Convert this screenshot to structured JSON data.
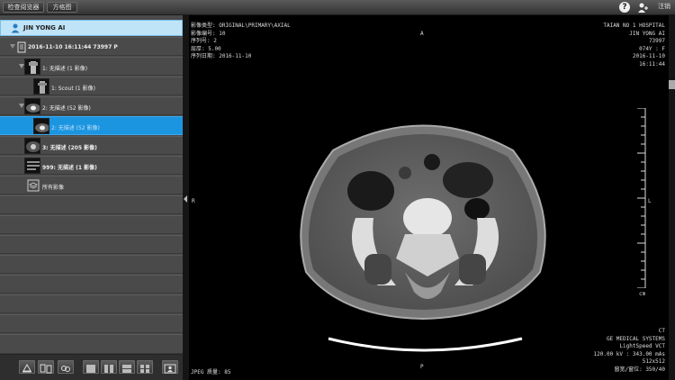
{
  "toolbar": {
    "btn1": "检查阅览器",
    "btn2": "方格图",
    "help": "?",
    "exit": "注销"
  },
  "patient": {
    "name": "JIN YONG AI"
  },
  "tree": {
    "study": "2016-11-10 16:11:44 73997 P",
    "series": [
      {
        "label": "1: 无描述 (1 影像)"
      },
      {
        "label": "1: Scout (1 影像)"
      },
      {
        "label": "2: 无描述 (52 影像)"
      },
      {
        "label": "2: 无描述 (52 影像)"
      },
      {
        "label": "3: 无描述 (205 影像)"
      },
      {
        "label": "999: 无描述 (1 影像)"
      },
      {
        "label": "所有影像"
      }
    ]
  },
  "overlay": {
    "tl": [
      "影像类型: ORIGINAL\\PRIMARY\\AXIAL",
      "影像编号: 10",
      "序列号: 2",
      "层厚: 5.00",
      "序列日期: 2016-11-10"
    ],
    "tr": [
      "TAIAN NO 1 HOSPITAL",
      "JIN YONG AI",
      "73997",
      "074Y : F",
      "2016-11-10",
      "16:11:44"
    ],
    "br": [
      "CT",
      "GE MEDICAL SYSTEMS",
      "LightSpeed VCT",
      "120.00 kV : 343.00 mAs",
      "512x512",
      "窗宽/窗位: 350/40"
    ],
    "orientation": {
      "top": "A",
      "right": "R",
      "left": "L",
      "bottom": "P"
    },
    "ruler_unit": "cm",
    "jpeg": "JPEG 质量: 85"
  },
  "colors": {
    "selected": "#1c95e0",
    "patient_bg": "#bfe3f7"
  }
}
